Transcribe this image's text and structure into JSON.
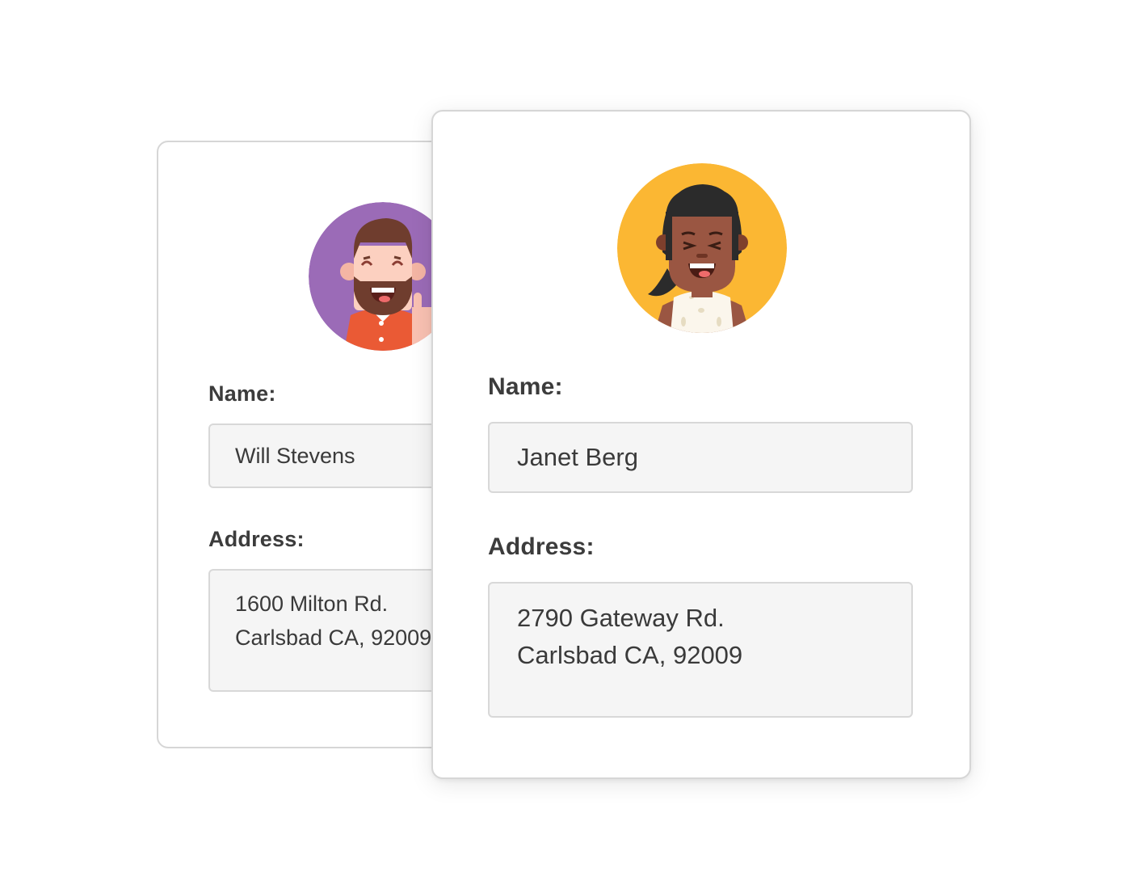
{
  "contacts": [
    {
      "name_label": "Name:",
      "name_value": "Will Stevens",
      "address_label": "Address:",
      "address_line1": "1600 Milton Rd.",
      "address_line2": "Carlsbad CA, 92009",
      "avatar_bg": "#9b6bb7"
    },
    {
      "name_label": "Name:",
      "name_value": "Janet Berg",
      "address_label": "Address:",
      "address_line1": "2790 Gateway Rd.",
      "address_line2": "Carlsbad CA, 92009",
      "avatar_bg": "#fbb733"
    }
  ]
}
